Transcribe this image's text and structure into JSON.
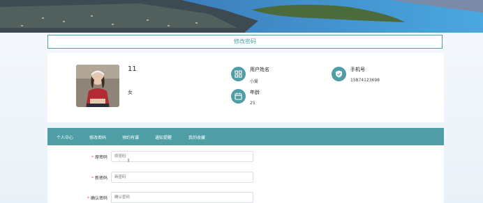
{
  "page": {
    "title": "修改密码"
  },
  "profile": {
    "username": "11",
    "gender": "女",
    "fields": [
      {
        "label": "用户姓名",
        "value": "小爱"
      },
      {
        "label": "手机号",
        "value": "15874123698"
      },
      {
        "label": "年龄",
        "value": "25"
      }
    ]
  },
  "tabs": [
    "个人中心",
    "修改密码",
    "预约有课",
    "通知提醒",
    "我的收藏"
  ],
  "form": {
    "fields": [
      {
        "label": "原密码",
        "placeholder": "原密码"
      },
      {
        "label": "新密码",
        "placeholder": "新密码"
      },
      {
        "label": "确认密码",
        "placeholder": "确认密码"
      }
    ]
  },
  "colors": {
    "accent": "#4f9ea6"
  },
  "icons": [
    "grid-icon",
    "shield-icon",
    "calendar-icon",
    "text-cursor-icon"
  ]
}
